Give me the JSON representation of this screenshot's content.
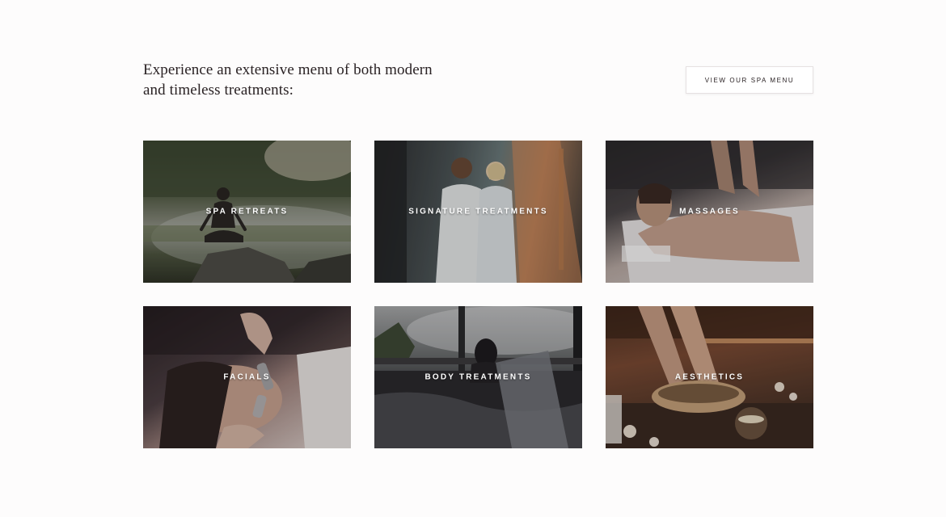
{
  "intro": {
    "line1": "Experience an extensive menu of both modern",
    "line2": "and timeless treatments:"
  },
  "menu_button": {
    "label": "VIEW OUR SPA MENU"
  },
  "tiles": [
    {
      "label": "SPA RETREATS"
    },
    {
      "label": "SIGNATURE TREATMENTS"
    },
    {
      "label": "MASSAGES"
    },
    {
      "label": "FACIALS"
    },
    {
      "label": "BODY TREATMENTS"
    },
    {
      "label": "AESTHETICS"
    }
  ]
}
